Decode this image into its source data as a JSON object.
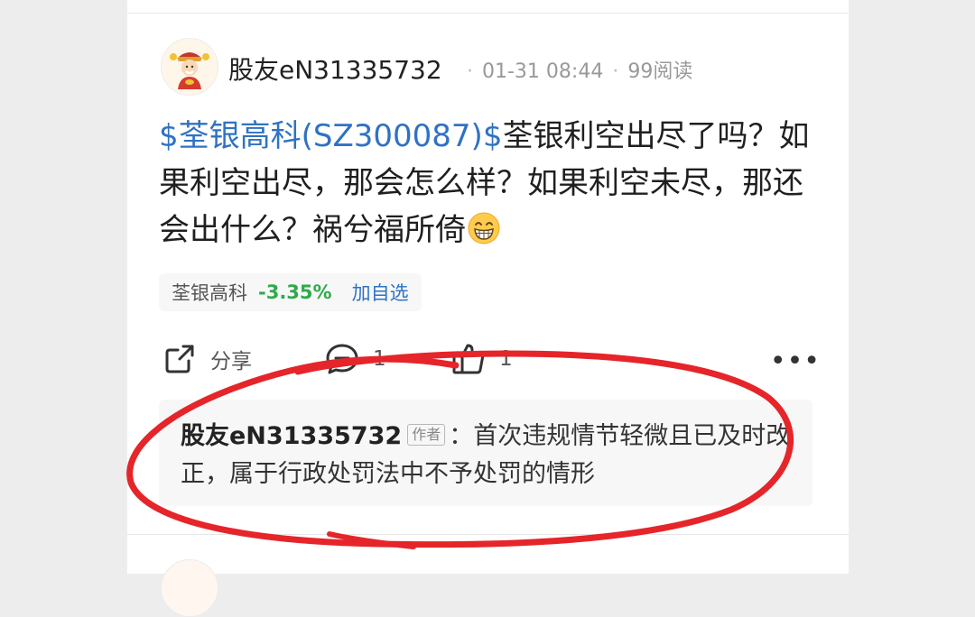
{
  "post": {
    "username": "股友eN31335732",
    "date": "01-31 08:44",
    "views": "99阅读",
    "stock_link": "$荃银高科(SZ300087)$",
    "text": "荃银利空出尽了吗？如果利空出尽，那会怎么样？如果利空未尽，那还会出什么？祸兮福所倚",
    "emoji": "grinning-face-icon"
  },
  "stock_tag": {
    "name": "荃银高科",
    "change": "-3.35%",
    "add_label": "加自选",
    "change_color": "#2eaa4a"
  },
  "actions": {
    "share_label": "分享",
    "comment_count": "1",
    "like_count": "1"
  },
  "comment": {
    "author": "股友eN31335732",
    "badge": "作者",
    "separator": "：",
    "text": "首次违规情节轻微且已及时改正，属于行政处罚法中不予处罚的情形"
  },
  "colors": {
    "link": "#2f72c4",
    "annotation": "#e5252a"
  }
}
